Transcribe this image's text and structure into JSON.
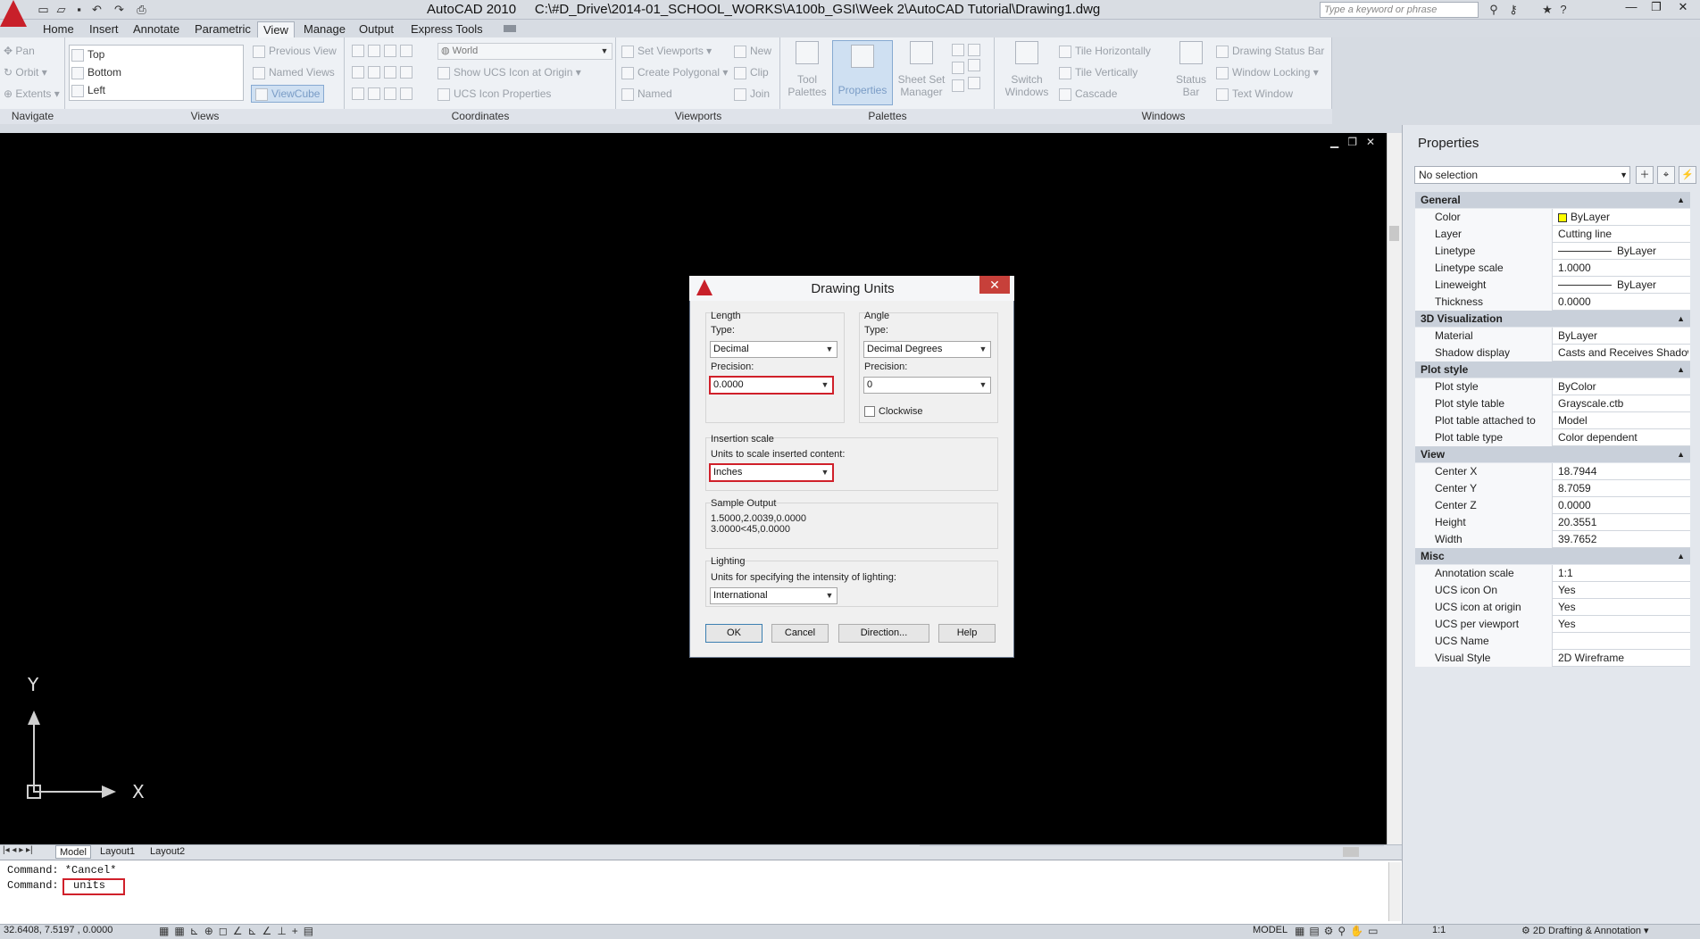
{
  "app": {
    "title": "AutoCAD 2010",
    "file_path": "C:\\#D_Drive\\2014-01_SCHOOL_WORKS\\A100b_GSI\\Week 2\\AutoCAD Tutorial\\Drawing1.dwg",
    "search_placeholder": "Type a keyword or phrase"
  },
  "tabs": [
    "Home",
    "Insert",
    "Annotate",
    "Parametric",
    "View",
    "Manage",
    "Output",
    "Express Tools"
  ],
  "active_tab": "View",
  "ribbon": {
    "navigate": {
      "title": "Navigate",
      "items": [
        "Pan",
        "Orbit",
        "Extents"
      ]
    },
    "views": {
      "title": "Views",
      "list": [
        "Top",
        "Bottom",
        "Left"
      ],
      "prev": "Previous View",
      "named": "Named Views",
      "viewcube": "ViewCube"
    },
    "coordinates": {
      "title": "Coordinates",
      "ucs": "World",
      "show_ucs": "Show UCS Icon at Origin",
      "ucs_props": "UCS Icon Properties"
    },
    "viewports": {
      "title": "Viewports",
      "set": "Set Viewports",
      "poly": "Create Polygonal",
      "named": "Named",
      "new": "New",
      "clip": "Clip",
      "join": "Join"
    },
    "palettes": {
      "title": "Palettes",
      "tool": "Tool Palettes",
      "props": "Properties",
      "sheet": "Sheet Set Manager"
    },
    "windows": {
      "title": "Windows",
      "switch": "Switch Windows",
      "tile_h": "Tile Horizontally",
      "tile_v": "Tile Vertically",
      "cascade": "Cascade",
      "status": "Status Bar",
      "dsb": "Drawing Status Bar",
      "lock": "Window Locking",
      "text": "Text Window"
    }
  },
  "layout_tabs": [
    "Model",
    "Layout1",
    "Layout2"
  ],
  "command": {
    "line1": "Command: *Cancel*",
    "prompt": "Command:",
    "input": "units"
  },
  "status": {
    "coords": "32.6408, 7.5197 , 0.0000",
    "model": "MODEL",
    "scale": "1:1",
    "workspace": "2D Drafting & Annotation"
  },
  "ucs": {
    "x": "X",
    "y": "Y"
  },
  "properties": {
    "title": "Properties",
    "selection": "No selection",
    "sections": [
      {
        "name": "General",
        "rows": [
          [
            "Color",
            "ByLayer"
          ],
          [
            "Layer",
            "Cutting line"
          ],
          [
            "Linetype",
            "ByLayer"
          ],
          [
            "Linetype scale",
            "1.0000"
          ],
          [
            "Lineweight",
            "ByLayer"
          ],
          [
            "Thickness",
            "0.0000"
          ]
        ]
      },
      {
        "name": "3D Visualization",
        "rows": [
          [
            "Material",
            "ByLayer"
          ],
          [
            "Shadow display",
            "Casts and Receives Shadows"
          ]
        ]
      },
      {
        "name": "Plot style",
        "rows": [
          [
            "Plot style",
            "ByColor"
          ],
          [
            "Plot style table",
            "Grayscale.ctb"
          ],
          [
            "Plot table attached to",
            "Model"
          ],
          [
            "Plot table type",
            "Color dependent"
          ]
        ]
      },
      {
        "name": "View",
        "rows": [
          [
            "Center X",
            "18.7944"
          ],
          [
            "Center Y",
            "8.7059"
          ],
          [
            "Center Z",
            "0.0000"
          ],
          [
            "Height",
            "20.3551"
          ],
          [
            "Width",
            "39.7652"
          ]
        ]
      },
      {
        "name": "Misc",
        "rows": [
          [
            "Annotation scale",
            "1:1"
          ],
          [
            "UCS icon On",
            "Yes"
          ],
          [
            "UCS icon at origin",
            "Yes"
          ],
          [
            "UCS per viewport",
            "Yes"
          ],
          [
            "UCS Name",
            ""
          ],
          [
            "Visual Style",
            "2D Wireframe"
          ]
        ]
      }
    ]
  },
  "dialog": {
    "title": "Drawing Units",
    "length": {
      "group": "Length",
      "type_label": "Type:",
      "type": "Decimal",
      "precision_label": "Precision:",
      "precision": "0.0000"
    },
    "angle": {
      "group": "Angle",
      "type_label": "Type:",
      "type": "Decimal Degrees",
      "precision_label": "Precision:",
      "precision": "0",
      "clockwise": "Clockwise"
    },
    "insertion": {
      "group": "Insertion scale",
      "label": "Units to scale inserted content:",
      "value": "Inches"
    },
    "sample": {
      "group": "Sample Output",
      "line1": "1.5000,2.0039,0.0000",
      "line2": "3.0000<45,0.0000"
    },
    "lighting": {
      "group": "Lighting",
      "label": "Units for specifying the intensity of lighting:",
      "value": "International"
    },
    "buttons": {
      "ok": "OK",
      "cancel": "Cancel",
      "direction": "Direction...",
      "help": "Help"
    }
  },
  "colors": {
    "highlight": "#d0202a",
    "canvas": "#000000",
    "color_swatch": "#ffff00"
  }
}
